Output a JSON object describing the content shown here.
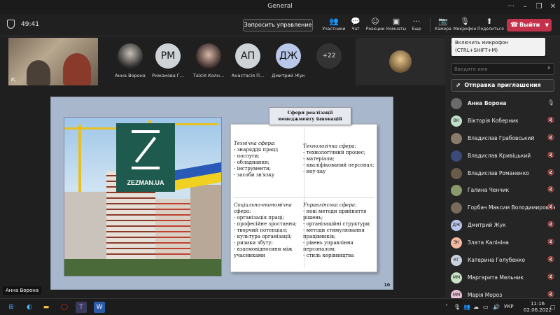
{
  "window": {
    "title": "General"
  },
  "toolbar": {
    "timer": "49:41",
    "request_control": "Запросить управление",
    "participants": "Участники",
    "chat": "Чат",
    "reactions": "Реакции",
    "rooms": "Комнаты",
    "more": "Еще",
    "camera": "Камера",
    "mic": "Микрофон",
    "share": "Поделиться",
    "leave": "Выйти"
  },
  "strip": {
    "participants": [
      {
        "initials": "",
        "name": "Анна Ворона",
        "color": "#555"
      },
      {
        "initials": "РМ",
        "name": "Рижакова Г...",
        "color": "#cfd3d6"
      },
      {
        "initials": "",
        "name": "Таїсія Колн...",
        "color": "#555"
      },
      {
        "initials": "АП",
        "name": "Анастасія П...",
        "color": "#cfd3d6"
      },
      {
        "initials": "ДЖ",
        "name": "Дмитрий Жук",
        "color": "#b9c7ea"
      }
    ],
    "more_count": "+22"
  },
  "slide": {
    "heading": "Сфери реалізації менеджменту інновацій",
    "logo_text": "ZEZMAN.UA",
    "page": "10",
    "q1_title": "Технічна сфера:",
    "q1_items": "- знаряддя праці;\n- послуги;\n- обладнання;\n- інструменти;\n- засоби зв'язку",
    "q2_title": "Технологічна сфера:",
    "q2_items": "- технологічний процес;\n- матеріали;\n- кваліфікований персонал;\n- ноу-хау",
    "q3_title": "Соціально-економічна сфера:",
    "q3_items": "- організація праці;\n- професійне зростання;\n- творчий потенціал;\n- культура організації;\n- ризики збуту;\n- взаємовідносини між учасниками",
    "q4_title": "Управлінська сфера:",
    "q4_items": "- нові методи прийняття рішень;\n- організаційні структури;\n- методи стимулювання працівників;\n- рівень управління персоналом;\n- стиль керівництва"
  },
  "speaker_label": "Анна Ворона",
  "panel": {
    "title": "Уч",
    "tooltip_line1": "Включить микрофон",
    "tooltip_line2": "(CTRL+SHIFT+M)",
    "search_placeholder": "Введите имя",
    "invite": "Отправка приглашения",
    "people": [
      {
        "initials": "",
        "name": "Анна Ворона",
        "color": "#6a6a6a",
        "mic": "🎙",
        "bold": true
      },
      {
        "initials": "ВК",
        "name": "Вікторія Коберник",
        "color": "#bfe0c9",
        "mic": "🔇"
      },
      {
        "initials": "",
        "name": "Владислав Грабовський",
        "color": "#8a7a6a",
        "mic": "🔇"
      },
      {
        "initials": "",
        "name": "Владислав Кривіцький",
        "color": "#3b4a7a",
        "mic": "🔇"
      },
      {
        "initials": "",
        "name": "Владислав Романенко",
        "color": "#6a5a4a",
        "mic": "🔇"
      },
      {
        "initials": "",
        "name": "Галина Ченчик",
        "color": "#8a9a6a",
        "mic": "🔇"
      },
      {
        "initials": "",
        "name": "Горбач Максим Володимирович",
        "color": "#7a6a5a",
        "mic": "🔇"
      },
      {
        "initials": "ДЖ",
        "name": "Дмитрий Жук",
        "color": "#b9c7ea",
        "mic": "🔇"
      },
      {
        "initials": "ЗК",
        "name": "Злата Калініна",
        "color": "#f3b8a0",
        "mic": "🔇"
      },
      {
        "initials": "КГ",
        "name": "Катерина Голубенко",
        "color": "#c9d2dc",
        "mic": "🔇"
      },
      {
        "initials": "ММ",
        "name": "Маргарита Мельник",
        "color": "#c9e3c4",
        "mic": "🔇"
      },
      {
        "initials": "ММ",
        "name": "Марія Мороз",
        "color": "#e8c0d4",
        "mic": "🔇"
      }
    ]
  },
  "taskbar": {
    "lang": "УКР",
    "time": "11:16",
    "date": "02.06.2022"
  }
}
